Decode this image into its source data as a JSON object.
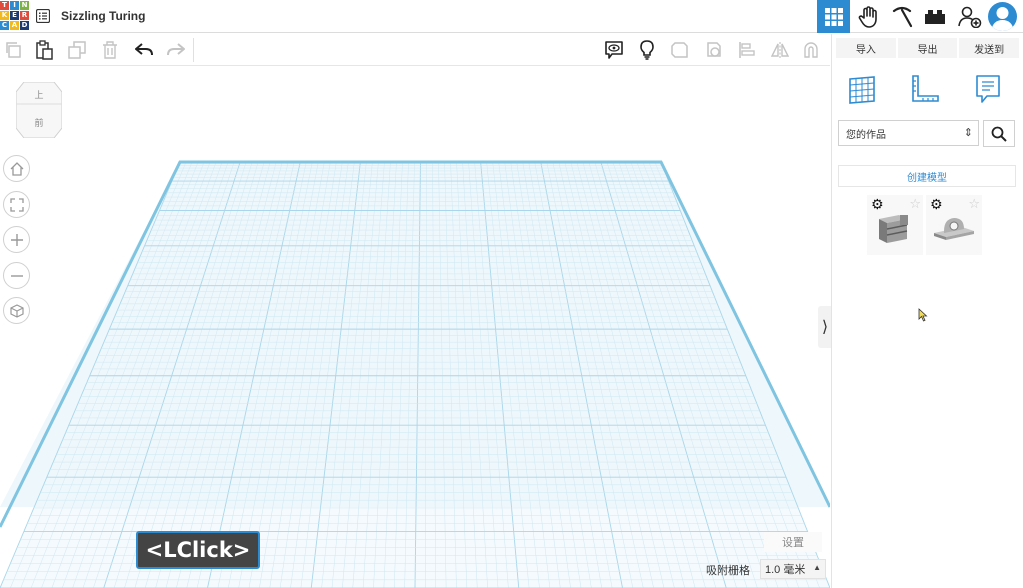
{
  "header": {
    "logo_letters": [
      "T",
      "I",
      "N",
      "K",
      "E",
      "R",
      "C",
      "A",
      "D"
    ],
    "title": "Sizzling Turing"
  },
  "viewport": {
    "view_cube_top": "上",
    "view_cube_front": "前",
    "settings_label": "设置",
    "snap_label": "吸附栅格",
    "snap_value": "1.0 毫米",
    "click_overlay": "<LClick>"
  },
  "panel": {
    "tabs": [
      "导入",
      "导出",
      "发送到"
    ],
    "dropdown_value": "您的作品",
    "create_label": "创建模型"
  },
  "colors": {
    "accent": "#2d8bd2",
    "grid_line": "#cfe8f3",
    "grid_major": "#a9d6ea",
    "grid_edge": "#7fc4e0"
  }
}
